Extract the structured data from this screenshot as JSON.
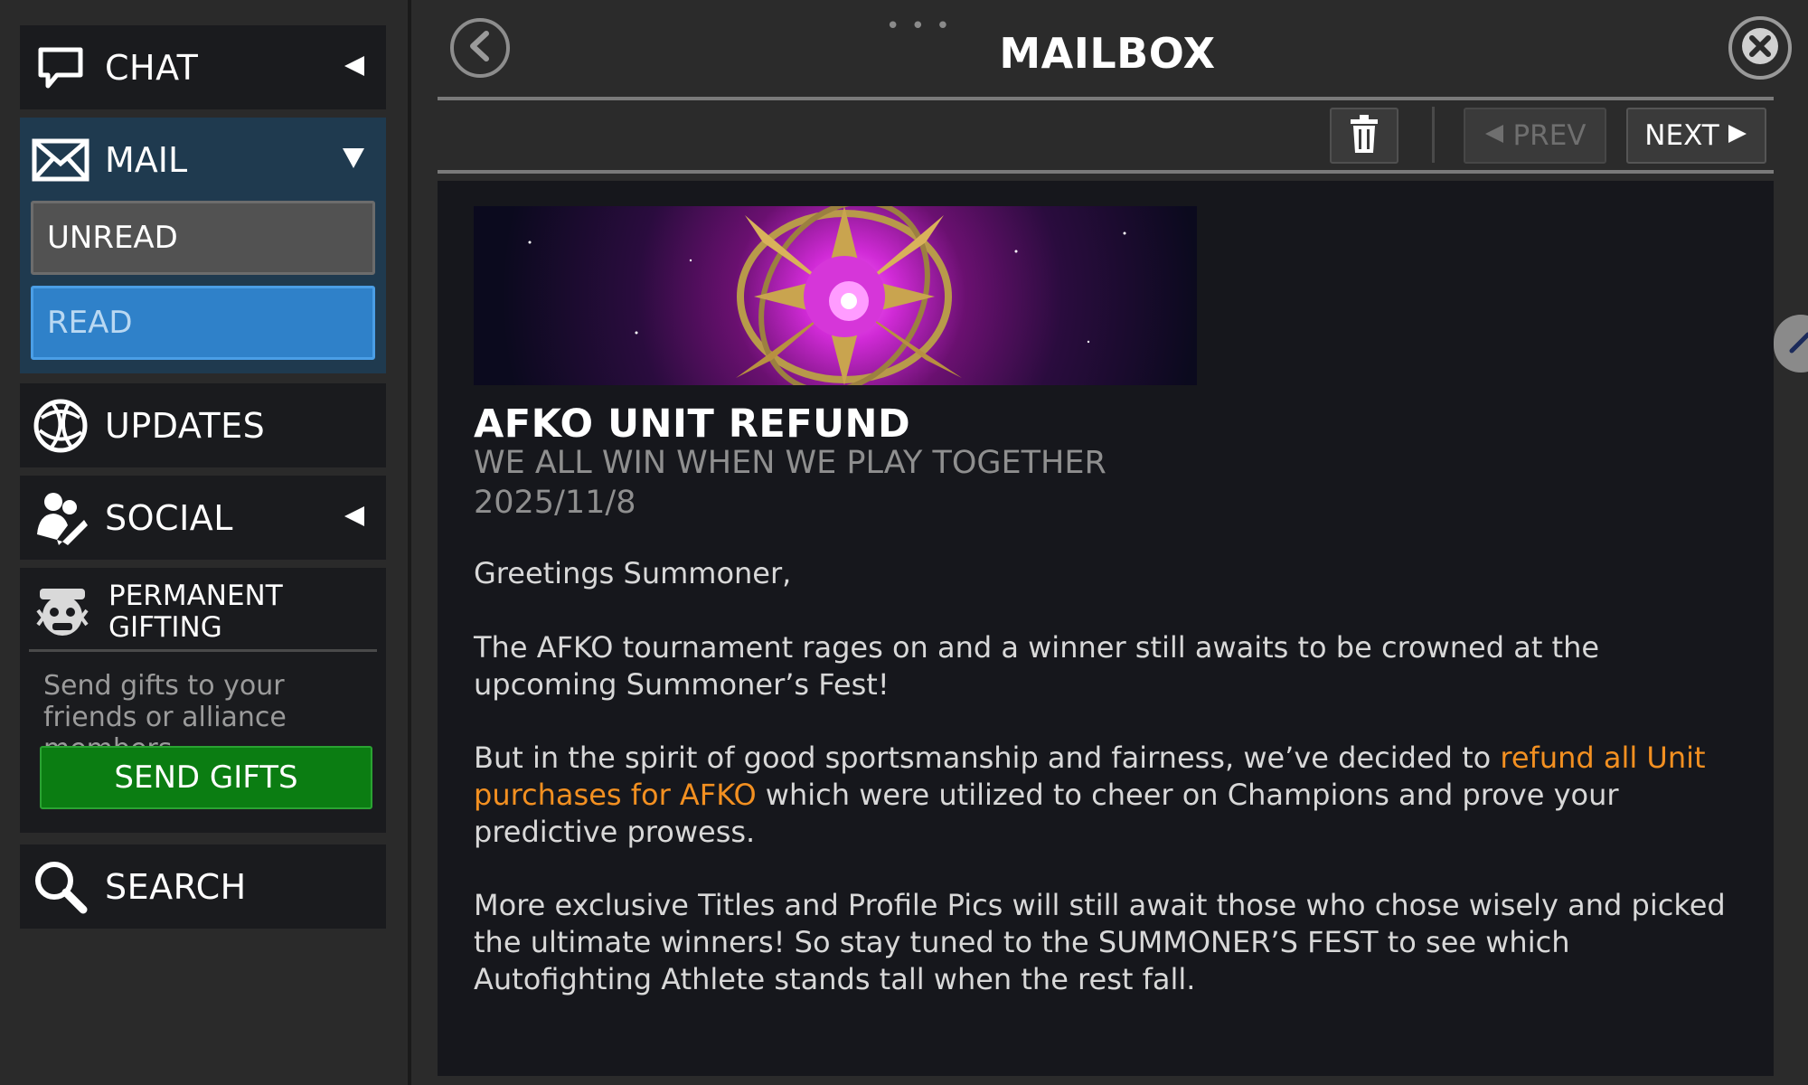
{
  "sidebar": {
    "chat_label": "CHAT",
    "mail_label": "MAIL",
    "unread_label": "UNREAD",
    "read_label": "READ",
    "updates_label": "UPDATES",
    "social_label": "SOCIAL",
    "gifting": {
      "title": "PERMANENT GIFTING",
      "description": "Send gifts to your friends or alliance members.",
      "button_label": "SEND GIFTS"
    },
    "search_label": "SEARCH"
  },
  "header": {
    "title": "MAILBOX",
    "grip": "• • •"
  },
  "toolbar": {
    "prev_label": "PREV",
    "next_label": "NEXT"
  },
  "mail": {
    "title": "AFKO UNIT REFUND",
    "subtitle": "WE ALL WIN WHEN WE PLAY TOGETHER",
    "date": "2025/11/8",
    "greeting": "Greetings Summoner,",
    "para1": "The AFKO tournament rages on and a winner still awaits to be crowned at the upcoming Summoner’s Fest!",
    "para2_a": "But in the spirit of good sportsmanship and fairness, we’ve decided to ",
    "para2_highlight": "refund all Unit purchases for AFKO",
    "para2_b": " which were utilized to cheer on Champions and prove your predictive prowess.",
    "para3": "More exclusive Titles and Profile Pics will still await those who chose wisely and picked the ultimate winners! So stay tuned to the SUMMONER’S FEST to see which Autofighting Athlete stands tall when the rest fall."
  },
  "colors": {
    "mail_section_bg": "#1f3a4f",
    "read_tab": "#2f81c9",
    "send_gifts": "#0b7d12",
    "highlight": "#f39021"
  }
}
